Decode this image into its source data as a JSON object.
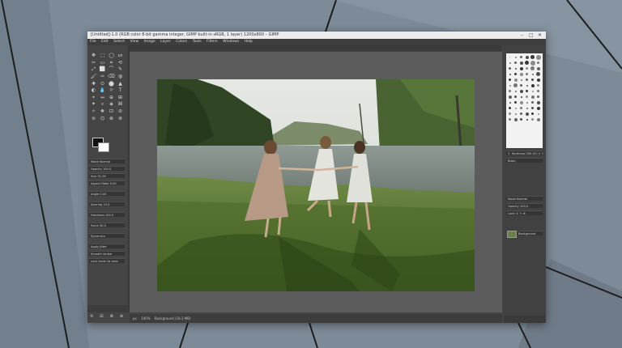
{
  "window": {
    "title": "[Untitled]-1.0 (RGB color 8-bit gamma integer, GIMP built-in sRGB, 1 layer) 1200x800 – GIMP",
    "controls": {
      "minimize": "–",
      "maximize": "□",
      "close": "✕"
    }
  },
  "menubar": [
    "File",
    "Edit",
    "Select",
    "View",
    "Image",
    "Layer",
    "Colors",
    "Tools",
    "Filters",
    "Windows",
    "Help"
  ],
  "toolbox": {
    "tools": [
      "✥",
      "⬚",
      "◯",
      "ᔕ",
      "✂",
      "▭",
      "⌗",
      "⟲",
      "⤢",
      "⬜",
      "⌒",
      "✎",
      "🖌",
      "✑",
      "⌫",
      "◍",
      "✚",
      "⊙",
      "⬤",
      "▲",
      "◐",
      "💧",
      "☼",
      "T",
      "⌖",
      "↔",
      "⊕",
      "⊞",
      "✦",
      "⌕",
      "◈",
      "⌘",
      "✧",
      "❖",
      "⊡",
      "⊘",
      "≋",
      "⌬",
      "⊗",
      "⊛"
    ],
    "foreground_color": "#111111",
    "background_color": "#ffffff",
    "options": [
      "Mode  Normal",
      "Opacity  100.0",
      "Size  51.00",
      "Aspect Ratio  0.00",
      "Angle  0.00",
      "Spacing  10.0",
      "Hardness  100.0",
      "Force  50.0",
      "Dynamics",
      "Apply Jitter",
      "Smooth stroke",
      "Lock brush to view"
    ],
    "bottom_icons": [
      "⟲",
      "⊟",
      "⊗",
      "⊕"
    ]
  },
  "image": {
    "description_icon": "photo-canvas"
  },
  "statusbar": {
    "units": "px",
    "zoom": "100%",
    "text": "Background (18.3 MB)"
  },
  "dock": {
    "options": [
      "2. Hardness 050 (51 × 51)",
      "Basic,",
      "Mode  Normal",
      "Opacity  100.0",
      "Lock: ⊡ ✎ ⊕",
      "Background"
    ],
    "bottom_icons": [
      "⊕",
      "⬆",
      "⬇",
      "⊗"
    ]
  },
  "colors": {
    "window_bg": "#454545",
    "canvas_bg": "#5c5c5c",
    "wallpaper": "#7b8794"
  }
}
